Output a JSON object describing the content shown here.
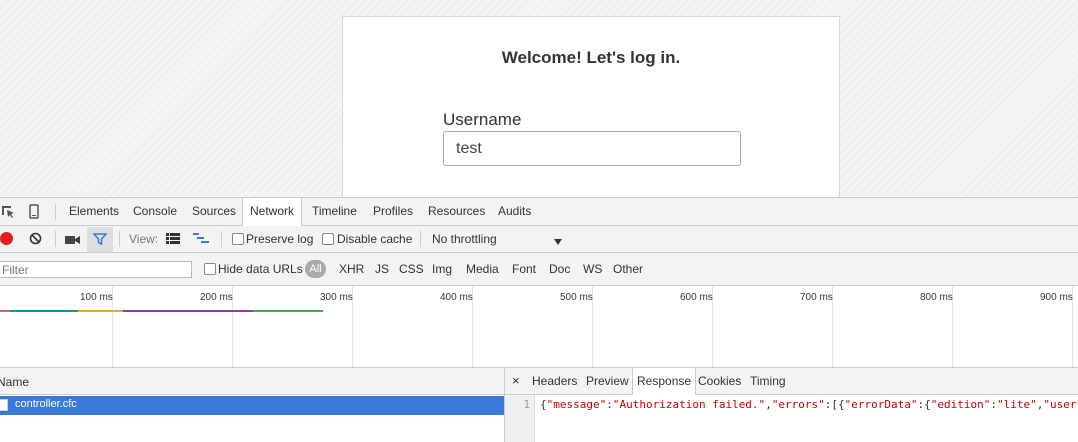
{
  "login": {
    "title": "Welcome! Let's log in.",
    "username_label": "Username",
    "username_value": "test"
  },
  "devtools": {
    "tabs": [
      "Elements",
      "Console",
      "Sources",
      "Network",
      "Timeline",
      "Profiles",
      "Resources",
      "Audits"
    ],
    "active_tab": "Network",
    "toolbar": {
      "view_label": "View:",
      "preserve_log": "Preserve log",
      "disable_cache": "Disable cache",
      "throttling": "No throttling",
      "record_color": "#e02020",
      "filter_active_color": "#3b79d8"
    },
    "filterbar": {
      "placeholder": "Filter",
      "hide_data_urls": "Hide data URLs",
      "types": [
        "All",
        "XHR",
        "JS",
        "CSS",
        "Img",
        "Media",
        "Font",
        "Doc",
        "WS",
        "Other"
      ]
    },
    "timeline": {
      "ticks": [
        "100 ms",
        "200 ms",
        "300 ms",
        "400 ms",
        "500 ms",
        "600 ms",
        "700 ms",
        "800 ms",
        "900 ms"
      ],
      "segment_colors": [
        "#e0588f",
        "#009a8e",
        "#f0a31e",
        "#9b36b7",
        "#2db84e"
      ]
    },
    "requests": {
      "column_name": "Name",
      "rows": [
        "controller.cfc"
      ],
      "selected_color": "#3879d9"
    },
    "details": {
      "close": "×",
      "tabs": [
        "Headers",
        "Preview",
        "Response",
        "Cookies",
        "Timing"
      ],
      "active_tab": "Response",
      "line_number": "1",
      "response_parts": {
        "p1": "{",
        "k1": "\"message\"",
        "p2": ":",
        "v1": "\"Authorization failed.\"",
        "p3": ",",
        "k2": "\"errors\"",
        "p4": ":[{",
        "k3": "\"errorData\"",
        "p5": ":{",
        "k4": "\"edition\"",
        "p6": ":",
        "v2": "\"lite\"",
        "p7": ",",
        "k5": "\"userr"
      }
    }
  }
}
